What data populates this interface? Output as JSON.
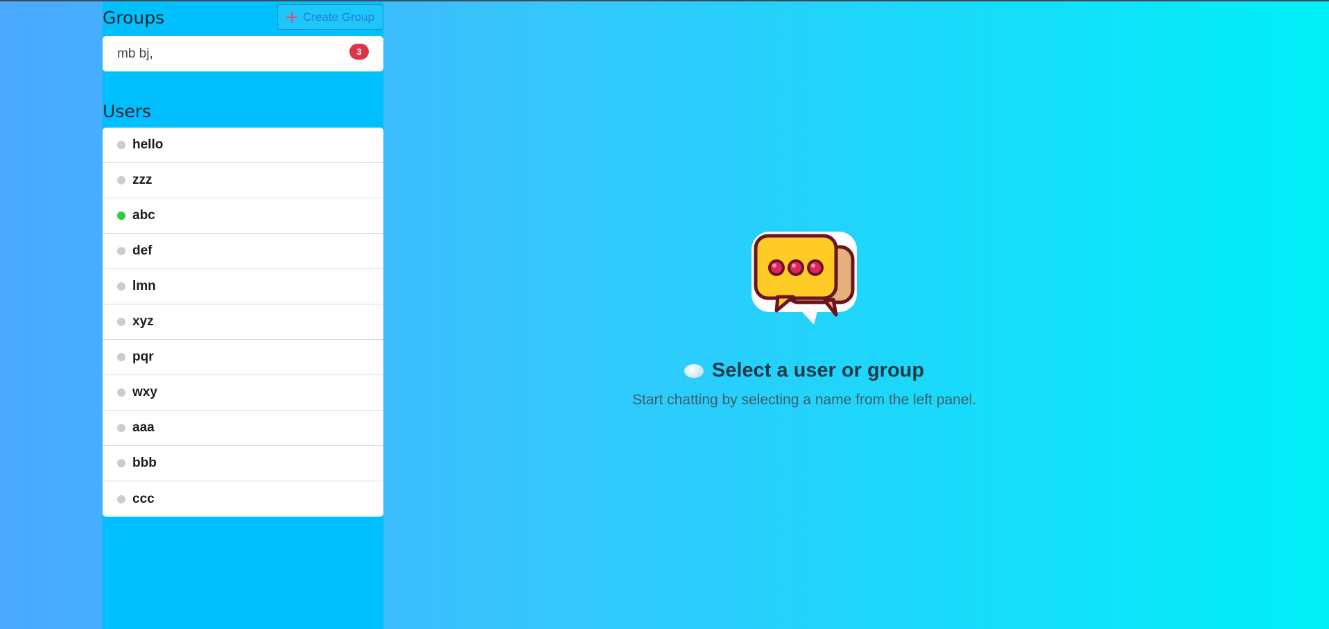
{
  "groups": {
    "title": "Groups",
    "create_label": "Create Group",
    "items": [
      {
        "name": "mb bj,",
        "unread": "3"
      }
    ]
  },
  "users": {
    "title": "Users",
    "items": [
      {
        "name": "hello",
        "status": "offline"
      },
      {
        "name": "zzz",
        "status": "offline"
      },
      {
        "name": "abc",
        "status": "online"
      },
      {
        "name": "def",
        "status": "offline"
      },
      {
        "name": "lmn",
        "status": "offline"
      },
      {
        "name": "xyz",
        "status": "offline"
      },
      {
        "name": "pqr",
        "status": "offline"
      },
      {
        "name": "wxy",
        "status": "offline"
      },
      {
        "name": "aaa",
        "status": "offline"
      },
      {
        "name": "bbb",
        "status": "offline"
      },
      {
        "name": "ccc",
        "status": "offline"
      }
    ]
  },
  "main": {
    "empty_title": "Select a user or group",
    "empty_subtitle": "Start chatting by selecting a name from the left panel.",
    "icon": "chat-bubbles-icon"
  },
  "colors": {
    "online": "#2ecc40",
    "offline": "#cccccc",
    "badge": "#dc3545",
    "sidebar": "#00bfff"
  }
}
